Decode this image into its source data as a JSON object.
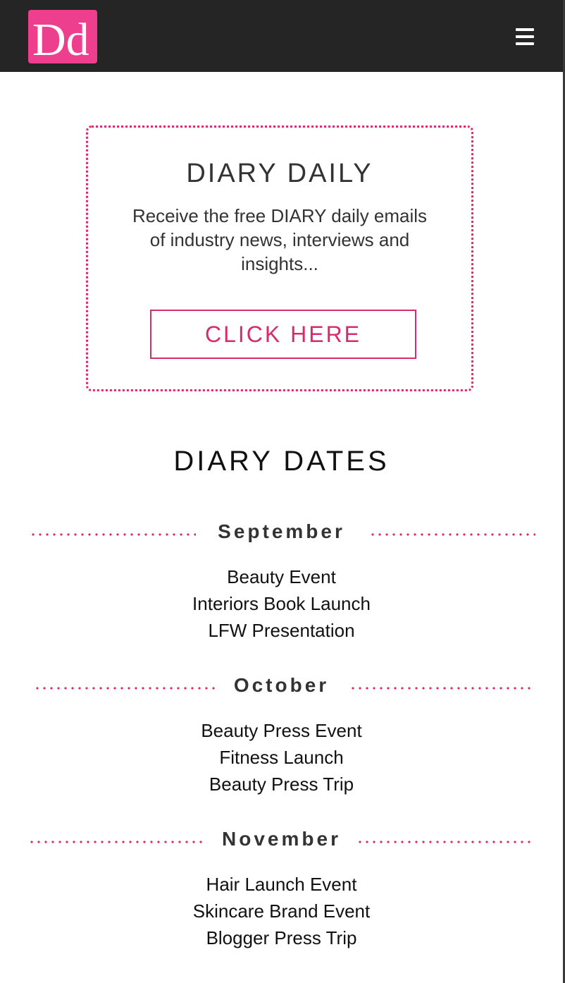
{
  "header": {
    "logo_text": "Dd",
    "brand_color": "#ee3f8e",
    "menu_icon": "hamburger-menu-icon"
  },
  "signup": {
    "title": "DIARY DAILY",
    "text": "Receive the free DIARY daily emails of industry news, interviews and insights...",
    "button_label": "CLICK HERE",
    "accent_color": "#d92a6b"
  },
  "diary_dates": {
    "title": "DIARY DATES",
    "months": [
      {
        "name": "September",
        "events": [
          "Beauty Event",
          "Interiors Book Launch",
          "LFW Presentation"
        ]
      },
      {
        "name": "October",
        "events": [
          "Beauty Press Event",
          "Fitness Launch",
          "Beauty Press Trip"
        ]
      },
      {
        "name": "November",
        "events": [
          "Hair Launch Event",
          "Skincare Brand Event",
          "Blogger Press Trip"
        ]
      }
    ]
  }
}
